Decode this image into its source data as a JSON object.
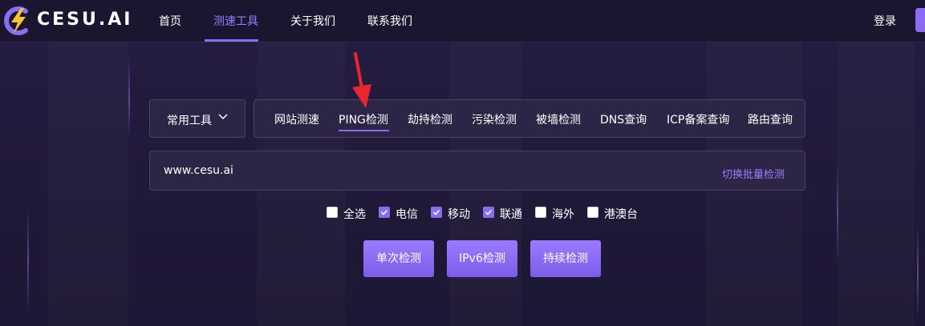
{
  "brand": {
    "name": "CESU.AI",
    "logo_icon": "lightning-c-logo-icon"
  },
  "nav": {
    "items": [
      {
        "label": "首页",
        "active": false
      },
      {
        "label": "测速工具",
        "active": true
      },
      {
        "label": "关于我们",
        "active": false
      },
      {
        "label": "联系我们",
        "active": false
      }
    ],
    "login_label": "登录"
  },
  "tool_select": {
    "label": "常用工具",
    "icon": "chevron-down-icon"
  },
  "tabs": [
    {
      "label": "网站测速",
      "active": false
    },
    {
      "label": "PING检测",
      "active": true
    },
    {
      "label": "劫持检测",
      "active": false
    },
    {
      "label": "污染检测",
      "active": false
    },
    {
      "label": "被墙检测",
      "active": false
    },
    {
      "label": "DNS查询",
      "active": false
    },
    {
      "label": "ICP备案查询",
      "active": false
    },
    {
      "label": "路由查询",
      "active": false
    }
  ],
  "url_input": {
    "value": "www.cesu.ai",
    "switch_label": "切换批量检测"
  },
  "checkboxes": [
    {
      "label": "全选",
      "checked": false
    },
    {
      "label": "电信",
      "checked": true
    },
    {
      "label": "移动",
      "checked": true
    },
    {
      "label": "联通",
      "checked": true
    },
    {
      "label": "海外",
      "checked": false
    },
    {
      "label": "港澳台",
      "checked": false
    }
  ],
  "buttons": [
    {
      "label": "单次检测"
    },
    {
      "label": "IPv6检测"
    },
    {
      "label": "持续检测"
    }
  ],
  "annotation": {
    "icon": "red-arrow-icon",
    "color": "#e8262d"
  },
  "colors": {
    "accent": "#8b6cf0",
    "background": "#221c3c",
    "navbar": "#1b1630"
  }
}
